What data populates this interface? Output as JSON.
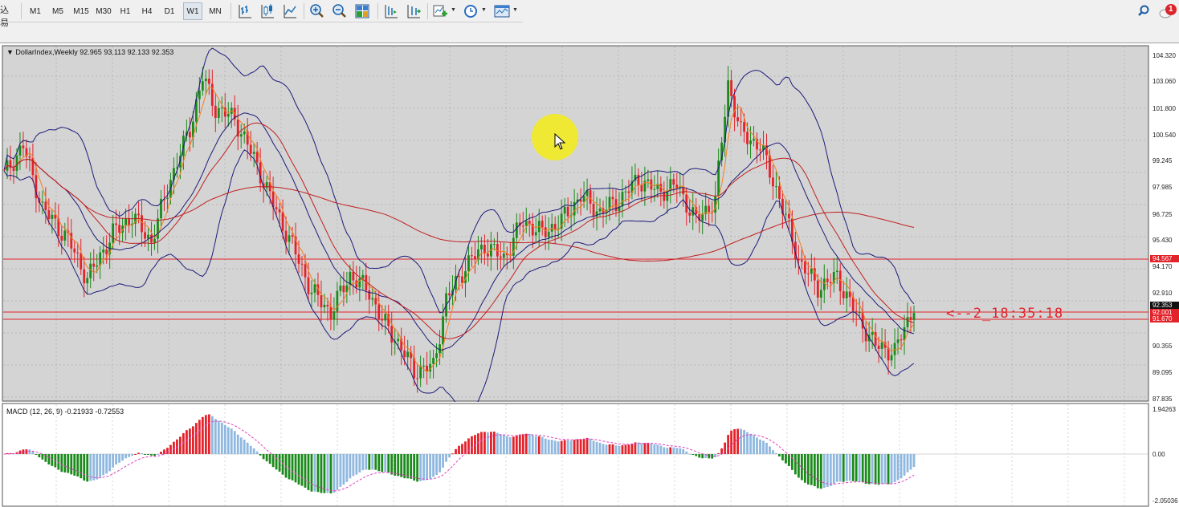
{
  "toolbar": {
    "left_cut_text": "込易",
    "timeframes": [
      "M1",
      "M5",
      "M15",
      "M30",
      "H1",
      "H4",
      "D1",
      "W1",
      "MN"
    ],
    "active_timeframe": "W1",
    "icons": [
      "bar-chart-icon",
      "candlestick-icon",
      "line-chart-icon",
      "zoom-in-icon",
      "zoom-out-icon",
      "tile-windows-icon",
      "chart-shift-icon",
      "autoscroll-icon",
      "indicators-icon",
      "periods-icon",
      "templates-icon"
    ],
    "notification_count": "1"
  },
  "chart": {
    "title": "DollarIndex,Weekly  92.965 93.113 92.133 92.353",
    "price_scale": [
      "104.320",
      "103.060",
      "101.800",
      "100.540",
      "99.245",
      "97.985",
      "96.725",
      "95.430",
      "94.170",
      "92.910",
      "90.355",
      "89.095",
      "87.835"
    ],
    "tags": [
      {
        "label": "94.567",
        "color": "#e3222a"
      },
      {
        "label": "92.353",
        "color": "#111111"
      },
      {
        "label": "92.001",
        "color": "#e3222a"
      },
      {
        "label": "91.670",
        "color": "#e3222a"
      }
    ],
    "countdown": "<--2_18:35:18",
    "colors": {
      "bull": "#1a8a1a",
      "bear": "#e3222a",
      "bollinger": "#1c1c7a",
      "ma_fast": "#f08020",
      "ma_slow": "#c02020"
    }
  },
  "macd": {
    "title": "MACD (12, 26, 9)  -0.21933 -0.72553",
    "scale": [
      "1.94263",
      "0.00",
      "-2.05036"
    ]
  }
}
